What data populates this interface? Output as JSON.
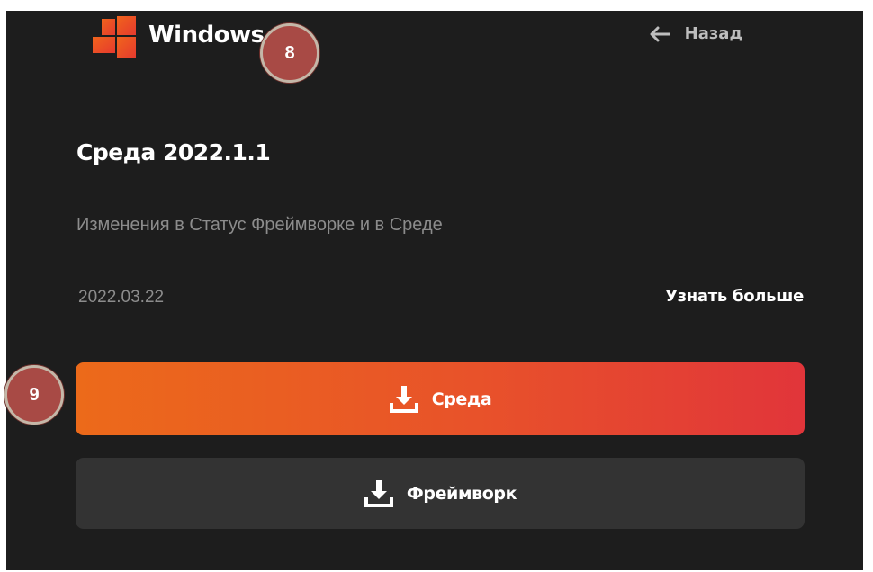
{
  "header": {
    "logo_text": "Windows",
    "back_label": "Назад"
  },
  "release": {
    "title": "Среда 2022.1.1",
    "description": "Изменения в Статус Фреймворке и в Среде",
    "date": "2022.03.22",
    "learn_more_label": "Узнать больше"
  },
  "buttons": {
    "primary_label": "Среда",
    "secondary_label": "Фреймворк"
  },
  "markers": {
    "m8": "8",
    "m9": "9"
  },
  "colors": {
    "background": "#1d1d1d",
    "primary_gradient_start": "#ec6a1a",
    "primary_gradient_end": "#e1353a",
    "secondary_button": "#333333",
    "marker": "#a84a45"
  },
  "icons": {
    "logo": "windows-logo-icon",
    "back": "arrow-left-icon",
    "download": "download-icon"
  }
}
